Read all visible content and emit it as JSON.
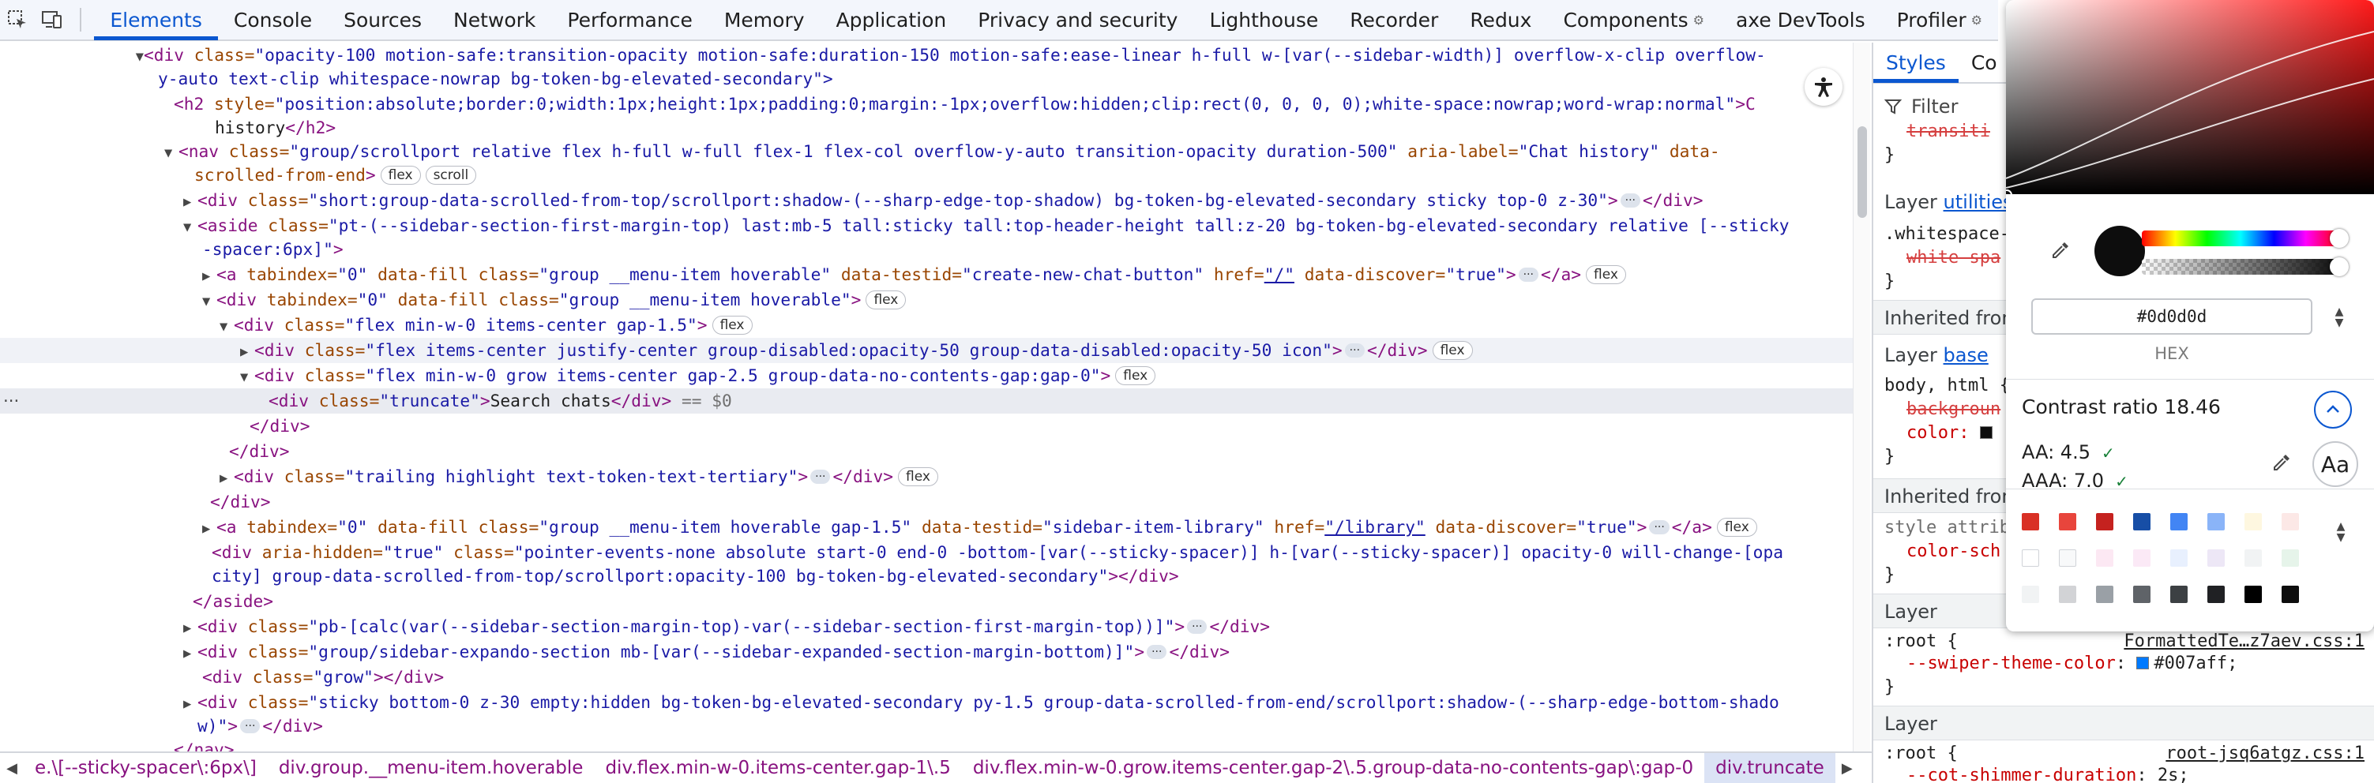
{
  "toolbar": {
    "tabs": [
      {
        "label": "Elements",
        "active": true
      },
      {
        "label": "Console"
      },
      {
        "label": "Sources"
      },
      {
        "label": "Network"
      },
      {
        "label": "Performance"
      },
      {
        "label": "Memory"
      },
      {
        "label": "Application"
      },
      {
        "label": "Privacy and security"
      },
      {
        "label": "Lighthouse"
      },
      {
        "label": "Recorder"
      },
      {
        "label": "Redux"
      },
      {
        "label": "Components"
      },
      {
        "label": "axe DevTools"
      },
      {
        "label": "Profiler"
      }
    ]
  },
  "tree": {
    "l1": {
      "tag": "<div",
      "a1": " class=",
      "v1": "\"opacity-100 motion-safe:transition-opacity motion-safe:duration-150 motion-safe:ease-linear h-full w-[var(--sidebar-width)] overflow-x-clip overflow-",
      "cont": "y-auto text-clip whitespace-nowrap bg-token-bg-elevated-secondary\">"
    },
    "l2": {
      "tag": "<h2",
      "a1": " style=",
      "v1": "\"position:absolute;border:0;width:1px;height:1px;padding:0;margin:-1px;overflow:hidden;clip:rect(0, 0, 0, 0);white-space:nowrap;word-wrap:normal\"",
      "rest": ">C",
      "cont": "history",
      "close": "</h2>"
    },
    "l3": {
      "tag": "<nav",
      "a1": " class=",
      "v1": "\"group/scrollport relative flex h-full w-full flex-1 flex-col overflow-y-auto transition-opacity duration-500\"",
      "a2": " aria-label=",
      "v2": "\"Chat history\"",
      "a3": " data-",
      "cont_attr": "scrolled-from-end",
      "end": ">",
      "pill1": "flex",
      "pill2": "scroll"
    },
    "l4": {
      "tag": "<div",
      "a1": " class=",
      "v1": "\"short:group-data-scrolled-from-top/scrollport:shadow-(--sharp-edge-top-shadow) bg-token-bg-elevated-secondary sticky top-0 z-30\"",
      "end": ">",
      "ell": "···",
      "close": "</div>"
    },
    "l5": {
      "tag": "<aside",
      "a1": " class=",
      "v1": "\"pt-(--sidebar-section-first-margin-top) last:mb-5 tall:sticky tall:top-header-height tall:z-20 bg-token-bg-elevated-secondary relative [--sticky",
      "cont": "-spacer:6px]\"",
      "end": ">"
    },
    "l6": {
      "tag": "<a",
      "a1": " tabindex=",
      "v1": "\"0\"",
      "a2": " data-fill class=",
      "v2": "\"group __menu-item hoverable\"",
      "a3": " data-testid=",
      "v3": "\"create-new-chat-button\"",
      "a4": " href=",
      "v4": "\"/\"",
      "a5": " data-discover=",
      "v5": "\"true\"",
      "end": ">",
      "ell": "···",
      "close": "</a>",
      "pill": "flex"
    },
    "l7": {
      "tag": "<div",
      "a1": " tabindex=",
      "v1": "\"0\"",
      "a2": " data-fill class=",
      "v2": "\"group __menu-item hoverable\"",
      "end": ">",
      "pill": "flex"
    },
    "l8": {
      "tag": "<div",
      "a1": " class=",
      "v1": "\"flex min-w-0 items-center gap-1.5\"",
      "end": ">",
      "pill": "flex"
    },
    "l9": {
      "tag": "<div",
      "a1": " class=",
      "v1": "\"flex items-center justify-center group-disabled:opacity-50 group-data-disabled:opacity-50 icon\"",
      "end": ">",
      "ell": "···",
      "close": "</div>",
      "pill": "flex"
    },
    "l10": {
      "tag": "<div",
      "a1": " class=",
      "v1": "\"flex min-w-0 grow items-center gap-2.5 group-data-no-contents-gap:gap-0\"",
      "end": ">",
      "pill": "flex"
    },
    "l11": {
      "tag": "<div",
      "a1": " class=",
      "v1": "\"truncate\"",
      "end": ">",
      "text": "Search chats",
      "close": "</div>",
      "eq": " == $0",
      "dots": "···"
    },
    "l12": {
      "close": "</div>"
    },
    "l13": {
      "close": "</div>"
    },
    "l14": {
      "tag": "<div",
      "a1": " class=",
      "v1": "\"trailing highlight text-token-text-tertiary\"",
      "end": ">",
      "ell": "···",
      "close": "</div>",
      "pill": "flex"
    },
    "l15": {
      "close": "</div>"
    },
    "l16": {
      "tag": "<a",
      "a1": " tabindex=",
      "v1": "\"0\"",
      "a2": " data-fill class=",
      "v2": "\"group __menu-item hoverable gap-1.5\"",
      "a3": " data-testid=",
      "v3": "\"sidebar-item-library\"",
      "a4": " href=",
      "v4": "\"/library\"",
      "a5": " data-discover=",
      "v5": "\"true\"",
      "end": ">",
      "ell": "···",
      "close": "</a>",
      "pill": "flex"
    },
    "l17": {
      "tag": "<div",
      "a1": " aria-hidden=",
      "v1": "\"true\"",
      "a2": " class=",
      "v2": "\"pointer-events-none absolute start-0 end-0 -bottom-[var(--sticky-spacer)] h-[var(--sticky-spacer)] opacity-0 will-change-[opa",
      "cont": "city] group-data-scrolled-from-top/scrollport:opacity-100 bg-token-bg-elevated-secondary\"",
      "end": ">",
      "close": "</div>"
    },
    "l18": {
      "close": "</aside>"
    },
    "l19": {
      "tag": "<div",
      "a1": " class=",
      "v1": "\"pb-[calc(var(--sidebar-section-margin-top)-var(--sidebar-section-first-margin-top))]\"",
      "end": ">",
      "ell": "···",
      "close": "</div>"
    },
    "l20": {
      "tag": "<div",
      "a1": " class=",
      "v1": "\"group/sidebar-expando-section mb-[var(--sidebar-expanded-section-margin-bottom)]\"",
      "end": ">",
      "ell": "···",
      "close": "</div>"
    },
    "l21": {
      "tag": "<div",
      "a1": " class=",
      "v1": "\"grow\"",
      "end": ">",
      "close": "</div>"
    },
    "l22": {
      "tag": "<div",
      "a1": " class=",
      "v1": "\"sticky bottom-0 z-30 empty:hidden bg-token-bg-elevated-secondary py-1.5 group-data-scrolled-from-end/scrollport:shadow-(--sharp-edge-bottom-shado",
      "cont": "w)\"",
      "end": ">",
      "ell": "···",
      "close": "</div>"
    },
    "l23": {
      "close": "</nav>"
    }
  },
  "breadcrumbs": {
    "items": [
      "e.\\[--sticky-spacer\\:6px\\]",
      "div.group.__menu-item.hoverable",
      "div.flex.min-w-0.items-center.gap-1\\.5",
      "div.flex.min-w-0.grow.items-center.gap-2\\.5.group-data-no-contents-gap\\:gap-0",
      "div.truncate"
    ]
  },
  "styles": {
    "tabs": [
      "Styles",
      "Co"
    ],
    "filter_placeholder": "Filter",
    "frag_transition": "transiti",
    "brace_close": "}",
    "layer_utilities_prefix": "Layer ",
    "layer_utilities_link": "utilities",
    "whitespace_selector": ".whitespace-",
    "whitespace_prop": "white-spa",
    "inherited1": "Inherited from",
    "layer_base_prefix": "Layer ",
    "layer_base_link": "base",
    "body_selector": "body, html {",
    "background_prop": "backgroun",
    "color_prop": "color:",
    "inherited2": "Inherited from",
    "style_attr": "style attrib",
    "color_scheme_prop": "color-sch",
    "layer1": "Layer",
    "root1_selector": ":root {",
    "root1_source": "FormattedTe…z7aev.css:1",
    "swiper_prop": "--swiper-theme-color",
    "swiper_value": "#007aff;",
    "swiper_color": "#007aff",
    "layer2": "Layer",
    "root2_selector": ":root {",
    "root2_source": "root-jsq6atgz.css:1",
    "shimmer_prop": "--cot-shimmer-duration",
    "shimmer_value": "2s;"
  },
  "picker": {
    "hex_value": "#0d0d0d",
    "format_label": "HEX",
    "current_color": "#0d0d0d",
    "contrast_label": "Contrast ratio",
    "contrast_value": "18.46",
    "aa_label": "AA: 4.5",
    "aaa_label": "AAA: 7.0",
    "aa_button": "Aa",
    "palette": [
      [
        "#d93025",
        "#e8453c",
        "#c5221f",
        "#174ea6",
        "#4285f4",
        "#8ab4f8",
        "#fef7e0",
        "#fce8e6"
      ],
      [
        "#ffffff",
        "#f8f9fa",
        "#fce8f3",
        "#fbe9f6",
        "#e8f0fe",
        "#ede7f6",
        "#f1f3f4",
        "#e6f4ea"
      ],
      [
        "#f1f3f4",
        "#d2d3d6",
        "#9aa0a6",
        "#5f6368",
        "#3c4043",
        "#202124",
        "#000000",
        "#0d0d0d"
      ]
    ]
  }
}
